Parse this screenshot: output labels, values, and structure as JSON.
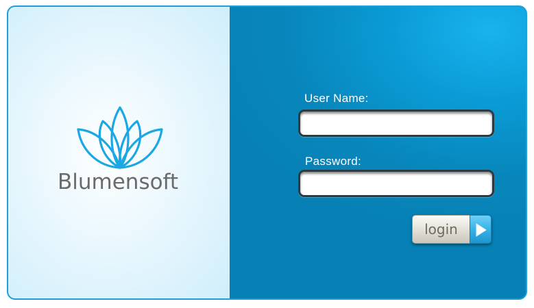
{
  "brand": {
    "name": "Blumensoft",
    "logo_icon": "lotus-icon"
  },
  "login_form": {
    "username_label": "User Name:",
    "username_value": "",
    "password_label": "Password:",
    "password_value": "",
    "submit_label": "login",
    "submit_icon": "play-arrow-icon"
  },
  "colors": {
    "accent_blue": "#0a8ec4",
    "logo_blue": "#1aa7e2",
    "left_panel_bg": "#d6f1fc",
    "brand_text": "#6b6b6b"
  }
}
